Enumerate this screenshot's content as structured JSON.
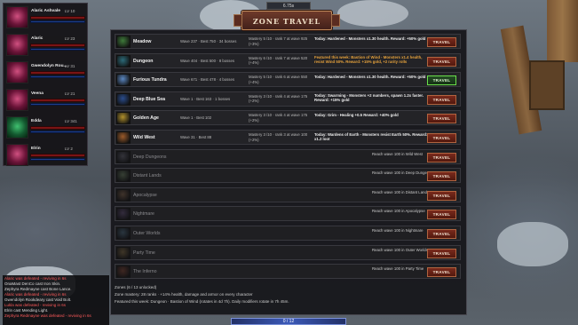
{
  "top_readout": "6.75s",
  "party": [
    {
      "name": "Alaric Ashvale",
      "level": "LV 10"
    },
    {
      "name": "Alaric",
      "level": "LV 23"
    },
    {
      "name": "Gwendolyn Rou...",
      "level": "LV 31"
    },
    {
      "name": "Veena",
      "level": "LV 21"
    },
    {
      "name": "Edda",
      "level": "LV 341"
    },
    {
      "name": "Elrin",
      "level": "LV 2"
    }
  ],
  "chat": [
    {
      "text": "Alaric was defeated - reviving in 6s",
      "color": "#ff5a5a"
    },
    {
      "text": "OnaMast DenCo cast Iron Skin.",
      "color": "#dddddd"
    },
    {
      "text": "Zephyra Redmayne cast Bone Lance.",
      "color": "#dddddd"
    },
    {
      "text": "Alaric was defeated - reviving in 6s",
      "color": "#ff5a5a"
    },
    {
      "text": "Gwendolyn Rookdeary cast Void Bolt.",
      "color": "#dddddd"
    },
    {
      "text": "Lukla was defeated - reviving in 6s",
      "color": "#ff5a5a"
    },
    {
      "text": "Elrin cast Mending Light.",
      "color": "#dddddd"
    },
    {
      "text": "Zephyra Redmayne was defeated - reviving in 6s",
      "color": "#ff5a5a"
    }
  ],
  "title": "ZONE TRAVEL",
  "travel_label": "TRAVEL",
  "zones": [
    {
      "name": "Meadow",
      "info": "Wave 237 · Best 750 · 34 bosses",
      "mastery": "Mastery 5 /10 · rank 7 at wave 925 (+3%)",
      "desc": "Today: Hardened - Monsters x1.30 health. Reward: +50% gold",
      "featured": false,
      "icon": "meadow-icon",
      "color": "#3e7a3a",
      "current": false
    },
    {
      "name": "Dungeon",
      "info": "Wave 404 · Best 500 · 8 bosses",
      "mastery": "Mastery 6 /10 · rank 7 at wave 520 (+4%)",
      "desc": "Featured this week: Bastion of Wind - Monsters x1.4 health, resist Wind 50%. Reward: +15% gold, +2 rarity rolls",
      "featured": true,
      "icon": "dungeon-icon",
      "color": "#2c6a78",
      "current": false
    },
    {
      "name": "Furious Tundra",
      "info": "Wave 671 · Best 478 · 4 bosses",
      "mastery": "Mastery 5 /10 · rank 6 at wave 550 (+4%)",
      "desc": "Today: Hardened - Monsters x1.30 health. Reward: +50% gold",
      "featured": false,
      "icon": "tundra-icon",
      "color": "#5a86c0",
      "current": true
    },
    {
      "name": "Deep Blue Sea",
      "info": "Wave 1 · Best 163 · 1 bosses",
      "mastery": "Mastery 3 /10 · rank 4 at wave 175 (+2%)",
      "desc": "Today: Swarming - Monsters +2 numbers, spawn 1.2x faster. Reward: +15% gold",
      "featured": false,
      "icon": "sea-icon",
      "color": "#2a4c8c",
      "current": false
    },
    {
      "name": "Golden Age",
      "info": "Wave 1 · Best 102",
      "mastery": "Mastery 3 /10 · rank 4 at wave 175 (+2%)",
      "desc": "Today: Grim - Healing +0.5 Reward: +40% gold",
      "featured": false,
      "icon": "golden-age-icon",
      "color": "#b0902c",
      "current": false
    },
    {
      "name": "Wild West",
      "info": "Wave 31 · Best 88",
      "mastery": "Mastery 3 /10 · rank 3 at wave 100 (+2%)",
      "desc": "Today: Wardens of Earth - Monsters resist Earth 50%. Reward: x1.2 loot",
      "featured": false,
      "icon": "wild-west-icon",
      "color": "#9a5a2a",
      "current": false
    }
  ],
  "locked_zones": [
    {
      "name": "Deep Dungeons",
      "req": "Reach wave 100 in Wild West",
      "icon": "deep-dungeons-icon",
      "color": "#3a3a42"
    },
    {
      "name": "Distant Lands",
      "req": "Reach wave 100 in Deep Dungeons",
      "icon": "distant-lands-icon",
      "color": "#3e4a3a"
    },
    {
      "name": "Apocalypse",
      "req": "Reach wave 100 in Distant Lands",
      "icon": "apocalypse-icon",
      "color": "#4a3a2e"
    },
    {
      "name": "Nightmare",
      "req": "Reach wave 100 in Apocalypse",
      "icon": "nightmare-icon",
      "color": "#3a3046"
    },
    {
      "name": "Outer Worlds",
      "req": "Reach wave 100 in Nightmare",
      "icon": "outer-worlds-icon",
      "color": "#2e3e4a"
    },
    {
      "name": "Party Time",
      "req": "Reach wave 100 in Outer Worlds",
      "icon": "party-time-icon",
      "color": "#4a3e2a"
    },
    {
      "name": "The Inferno",
      "req": "Reach wave 100 in Party Time",
      "icon": "inferno-icon",
      "color": "#4a2a22"
    }
  ],
  "footer": {
    "unlocked": "Zones (6 / 13 unlocked)",
    "mastery": "Zone mastery: 28 ranks · +14% health, damage and armor on every character",
    "featured": "Featured this week: Dungeon · Bastion of Wind (rotates in 4d 7h). Daily modifiers rotate in 7h 45m."
  },
  "bottom_bar": "0 / 12"
}
